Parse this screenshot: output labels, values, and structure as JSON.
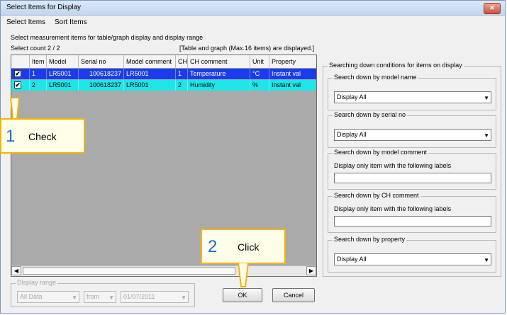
{
  "window": {
    "title": "Select Items for Display",
    "close_glyph": "✕"
  },
  "menu": {
    "items": [
      "Select Items",
      "Sort Items"
    ]
  },
  "instruction": "Select measurement items for table/graph display and display range",
  "select_count": "Select count 2 / 2",
  "max_note": "[Table and graph (Max.16 items) are displayed.]",
  "table": {
    "columns": [
      "Item",
      "Model",
      "Serial no",
      "Model comment",
      "CH",
      "CH comment",
      "Unit",
      "Property"
    ],
    "rows": [
      {
        "checked": true,
        "item": "1",
        "model": "LR5001",
        "serial": "100618237",
        "model_comment": "LR5001",
        "ch": "1",
        "ch_comment": "Temperature",
        "unit": "°C",
        "property": "Instant val",
        "bg": "#1a3cf0",
        "fg": "#ffffff"
      },
      {
        "checked": true,
        "item": "2",
        "model": "LR5001",
        "serial": "100618237",
        "model_comment": "LR5001",
        "ch": "2",
        "ch_comment": "Humidity",
        "unit": "%",
        "property": "Instant val",
        "bg": "#1ee6e6",
        "fg": "#000000"
      }
    ],
    "check_glyph": "✔",
    "scroll_left": "◀",
    "scroll_right": "▶"
  },
  "display_range": {
    "label": "Display range",
    "range_value": "All Data",
    "from_label": "from",
    "date_value": "01/07/2011",
    "arrow": "▼"
  },
  "buttons": {
    "ok": "OK",
    "cancel": "Cancel"
  },
  "search": {
    "title": "Searching down conditions for items on display",
    "model_name": {
      "label": "Search down by model name",
      "value": "Display All"
    },
    "serial_no": {
      "label": "Search down by serial no",
      "value": "Display All"
    },
    "model_comment": {
      "label": "Search down by model comment",
      "note": "Display only item with the following labels",
      "value": ""
    },
    "ch_comment": {
      "label": "Search down by CH comment",
      "note": "Display only item with the following labels",
      "value": ""
    },
    "property": {
      "label": "Search down by property",
      "value": "Display All"
    },
    "arrow": "▼"
  },
  "callouts": {
    "check": {
      "number": "1",
      "text": "Check"
    },
    "click": {
      "number": "2",
      "text": "Click"
    }
  },
  "colors": {
    "accent_border": "#f5b400",
    "callout_number": "#1d6bd8",
    "row1_bg": "#1a3cf0",
    "row2_bg": "#1ee6e6"
  }
}
